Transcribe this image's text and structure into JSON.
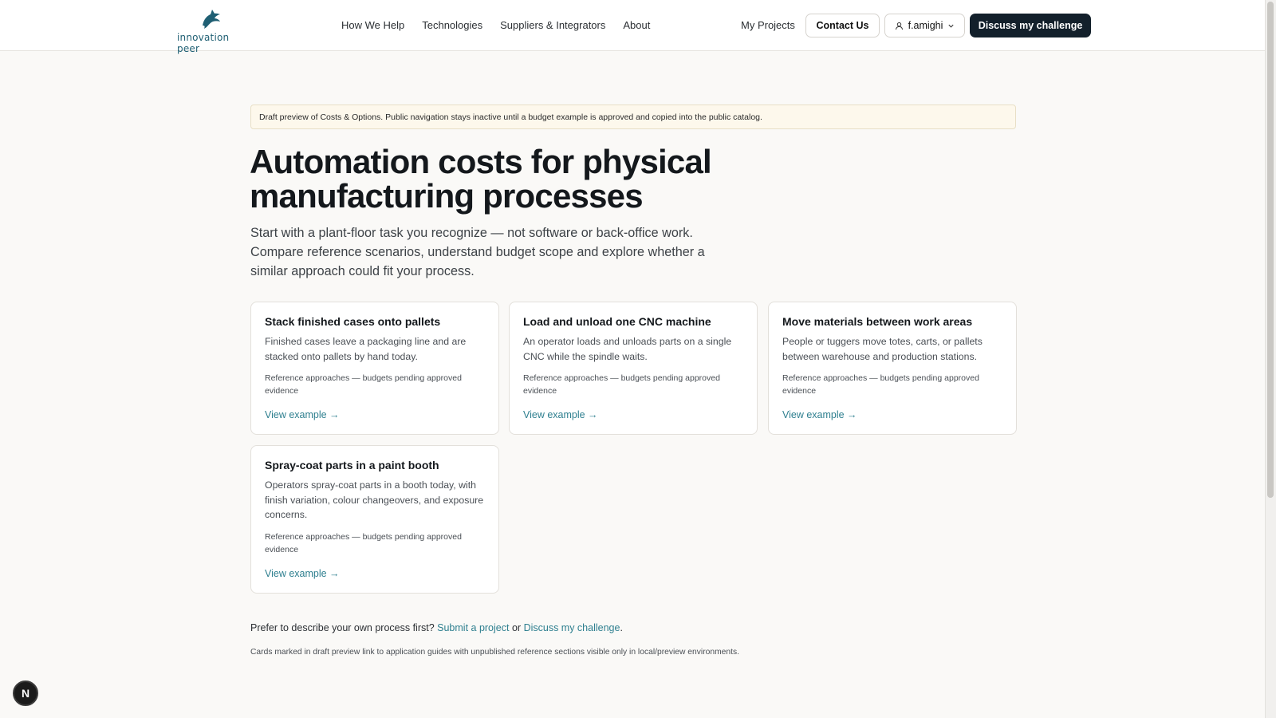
{
  "header": {
    "logo_text": "innovation peer",
    "nav": [
      "How We Help",
      "Technologies",
      "Suppliers & Integrators",
      "About"
    ],
    "my_projects": "My Projects",
    "contact": "Contact Us",
    "user": "f.amighi",
    "discuss": "Discuss my challenge"
  },
  "banner": "Draft preview of Costs & Options. Public navigation stays inactive until a budget example is approved and copied into the public catalog.",
  "title": "Automation costs for physical manufacturing processes",
  "subtitle": "Start with a plant-floor task you recognize — not software or back-office work. Compare reference scenarios, understand budget scope and explore whether a similar approach could fit your process.",
  "cards": [
    {
      "title": "Stack finished cases onto pallets",
      "desc": "Finished cases leave a packaging line and are stacked onto pallets by hand today.",
      "note": "Reference approaches — budgets pending approved evidence",
      "link": "View example →"
    },
    {
      "title": "Load and unload one CNC machine",
      "desc": "An operator loads and unloads parts on a single CNC while the spindle waits.",
      "note": "Reference approaches — budgets pending approved evidence",
      "link": "View example →"
    },
    {
      "title": "Move materials between work areas",
      "desc": "People or tuggers move totes, carts, or pallets between warehouse and production stations.",
      "note": "Reference approaches — budgets pending approved evidence",
      "link": "View example →"
    },
    {
      "title": "Spray-coat parts in a paint booth",
      "desc": "Operators spray-coat parts in a booth today, with finish variation, colour changeovers, and exposure concerns.",
      "note": "Reference approaches — budgets pending approved evidence",
      "link": "View example →"
    }
  ],
  "footer": {
    "prefix": "Prefer to describe your own process first?",
    "submit": "Submit a project",
    "or": "or",
    "discuss": "Discuss my challenge",
    "period": ".",
    "note": "Cards marked in draft preview link to application guides with unpublished reference sections visible only in local/preview environments."
  },
  "badge": "N",
  "colors": {
    "brand_dark": "#13202b",
    "link": "#2e7f8f",
    "banner_bg": "#fdf8ec"
  }
}
